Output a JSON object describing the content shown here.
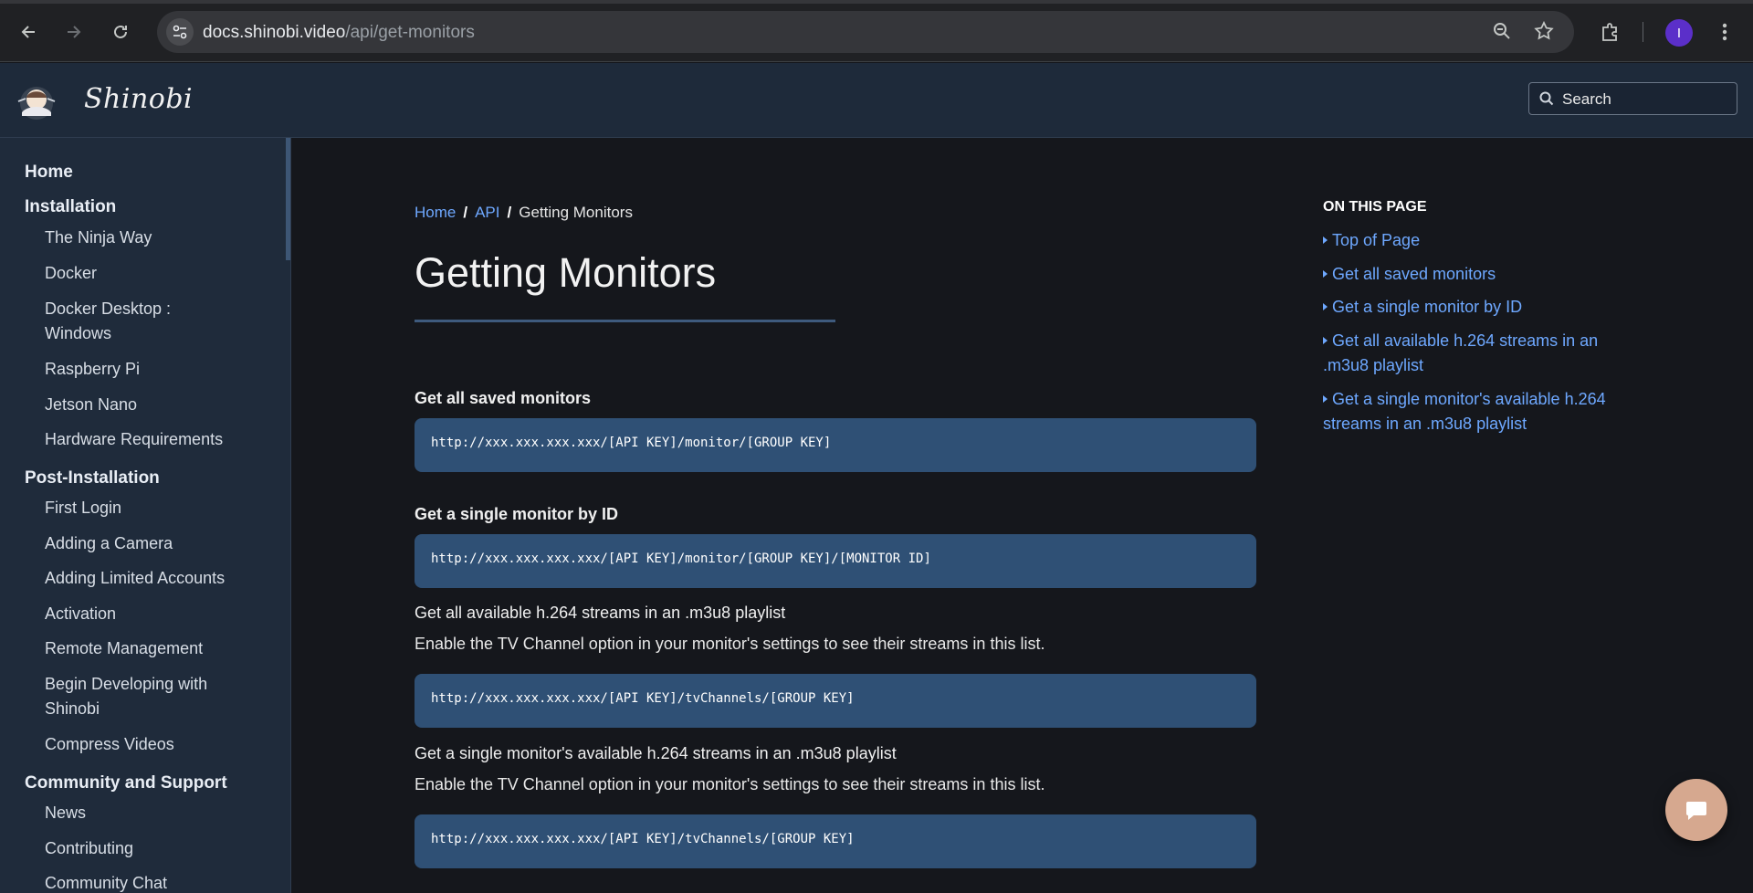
{
  "browser": {
    "url_host": "docs.shinobi.video",
    "url_path": "/api/get-monitors",
    "profile_initial": "I"
  },
  "site": {
    "brand": "Shinobi",
    "search_placeholder": "Search"
  },
  "sidebar": {
    "sections": [
      {
        "label": "Home",
        "items": []
      },
      {
        "label": "Installation",
        "items": [
          "The Ninja Way",
          "Docker",
          "Docker Desktop : Windows",
          "Raspberry Pi",
          "Jetson Nano",
          "Hardware Requirements"
        ]
      },
      {
        "label": "Post-Installation",
        "items": [
          "First Login",
          "Adding a Camera",
          "Adding Limited Accounts",
          "Activation",
          "Remote Management",
          "Begin Developing with Shinobi",
          "Compress Videos"
        ]
      },
      {
        "label": "Community and Support",
        "items": [
          "News",
          "Contributing",
          "Community Chat"
        ]
      }
    ]
  },
  "breadcrumb": {
    "home": "Home",
    "api": "API",
    "current": "Getting Monitors",
    "separator": "/"
  },
  "page": {
    "title": "Getting Monitors",
    "blocks": [
      {
        "heading": "Get all saved monitors",
        "code": "http://xxx.xxx.xxx.xxx/[API KEY]/monitor/[GROUP KEY]"
      },
      {
        "heading": "Get a single monitor by ID",
        "code": "http://xxx.xxx.xxx.xxx/[API KEY]/monitor/[GROUP KEY]/[MONITOR ID]"
      },
      {
        "heading": "Get all available h.264 streams in an .m3u8 playlist",
        "desc": "Enable the TV Channel option in your monitor's settings to see their streams in this list.",
        "code": "http://xxx.xxx.xxx.xxx/[API KEY]/tvChannels/[GROUP KEY]"
      },
      {
        "heading": "Get a single monitor's available h.264 streams in an .m3u8 playlist",
        "desc": "Enable the TV Channel option in your monitor's settings to see their streams in this list.",
        "code": "http://xxx.xxx.xxx.xxx/[API KEY]/tvChannels/[GROUP KEY]"
      }
    ]
  },
  "toc": {
    "title": "ON THIS PAGE",
    "items": [
      "Top of Page",
      "Get all saved monitors",
      "Get a single monitor by ID",
      "Get all available h.264 streams in an .m3u8 playlist",
      "Get a single monitor's available h.264 streams in an .m3u8 playlist"
    ]
  },
  "colors": {
    "link": "#6ea8ff",
    "code_bg": "#2f5075",
    "header_bg": "#1e2a3a",
    "sidebar_bg": "#1f2b3b",
    "main_bg": "#15171c"
  }
}
